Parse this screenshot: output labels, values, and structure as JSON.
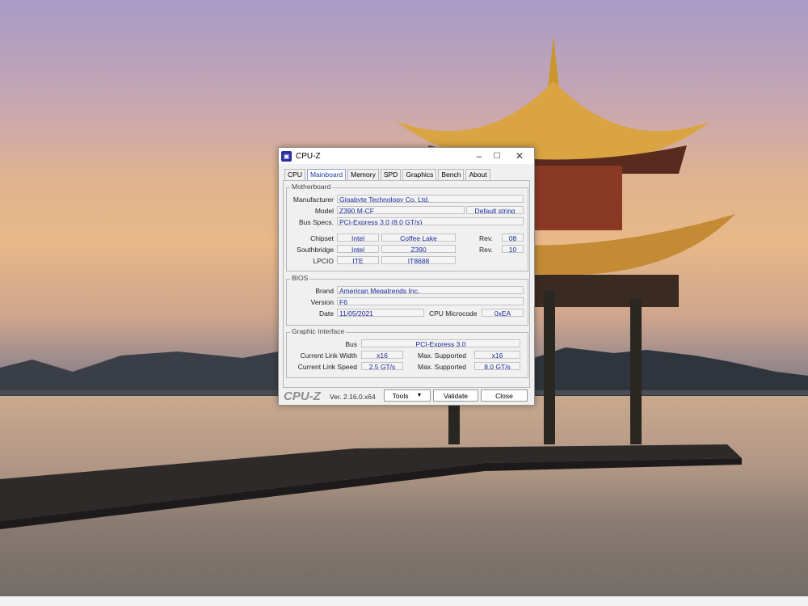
{
  "window": {
    "title": "CPU-Z",
    "tabs": [
      "CPU",
      "Mainboard",
      "Memory",
      "SPD",
      "Graphics",
      "Bench",
      "About"
    ],
    "active_tab": "Mainboard"
  },
  "motherboard": {
    "legend": "Motherboard",
    "manufacturer_label": "Manufacturer",
    "manufacturer": "Gigabyte Technology Co. Ltd.",
    "model_label": "Model",
    "model": "Z390 M-CF",
    "model_extra": "Default string",
    "bus_label": "Bus Specs.",
    "bus": "PCI-Express 3.0 (8.0 GT/s)",
    "chipset_label": "Chipset",
    "chipset_vendor": "Intel",
    "chipset_name": "Coffee Lake",
    "rev_label": "Rev.",
    "chipset_rev": "08",
    "southbridge_label": "Southbridge",
    "southbridge_vendor": "Intel",
    "southbridge_name": "Z390",
    "southbridge_rev": "10",
    "lpcio_label": "LPCIO",
    "lpcio_vendor": "ITE",
    "lpcio_name": "IT8688"
  },
  "bios": {
    "legend": "BIOS",
    "brand_label": "Brand",
    "brand": "American Megatrends Inc.",
    "version_label": "Version",
    "version": "F6",
    "date_label": "Date",
    "date": "11/05/2021",
    "microcode_label": "CPU Microcode",
    "microcode": "0xEA"
  },
  "graphic": {
    "legend": "Graphic Interface",
    "bus_label": "Bus",
    "bus": "PCI-Express 3.0",
    "link_width_label": "Current Link Width",
    "link_width": "x16",
    "max_supported_label": "Max. Supported",
    "max_width": "x16",
    "link_speed_label": "Current Link Speed",
    "link_speed": "2.5 GT/s",
    "max_speed": "8.0 GT/s"
  },
  "footer": {
    "brand": "CPU-Z",
    "version": "Ver. 2.16.0.x64",
    "tools": "Tools",
    "validate": "Validate",
    "close": "Close"
  },
  "icons": [
    "cpuz-app-icon",
    "minimize-icon",
    "maximize-icon",
    "close-icon",
    "dropdown-arrow-icon"
  ]
}
